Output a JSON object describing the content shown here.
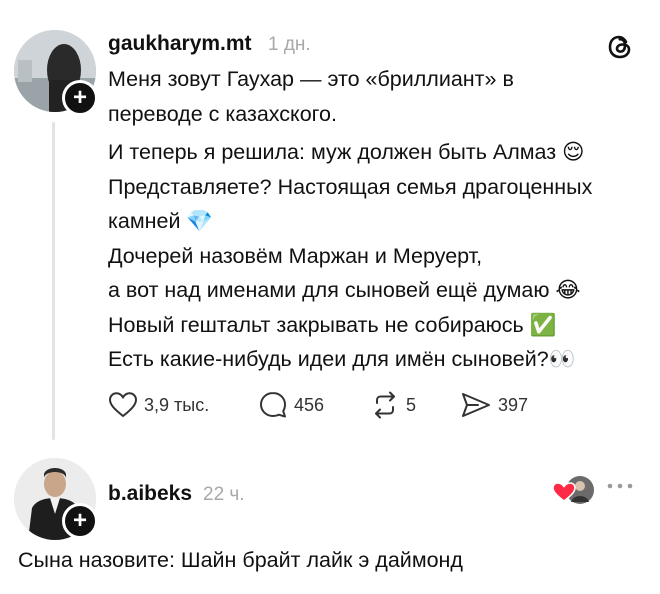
{
  "post": {
    "username": "gaukharym.mt",
    "time": "1 дн.",
    "lines": [
      "Меня зовут Гаухар — это «бриллиант» в переводе с казахского.",
      "И теперь я решила: муж должен быть Алмаз 😌",
      "Представляете? Настоящая семья драгоценных камней 💎",
      "Дочерей назовём Маржан и Меруерт,",
      "а вот над именами для сыновей ещё думаю 😂",
      "Новый гештальт закрывать не собираюсь ✅",
      "Есть какие-нибудь идеи для имён сыновей?👀"
    ],
    "actions": {
      "likes": "3,9 тыс.",
      "comments": "456",
      "reposts": "5",
      "shares": "397"
    }
  },
  "reply": {
    "username": "b.aibeks",
    "time": "22 ч.",
    "text": "Сына назовите: Шайн брайт лайк э даймонд"
  },
  "icons": {
    "app_logo": "threads-logo-icon",
    "like": "heart-icon",
    "comment": "comment-bubble-icon",
    "repost": "repost-icon",
    "share": "send-icon",
    "more": "more-dots-icon"
  }
}
